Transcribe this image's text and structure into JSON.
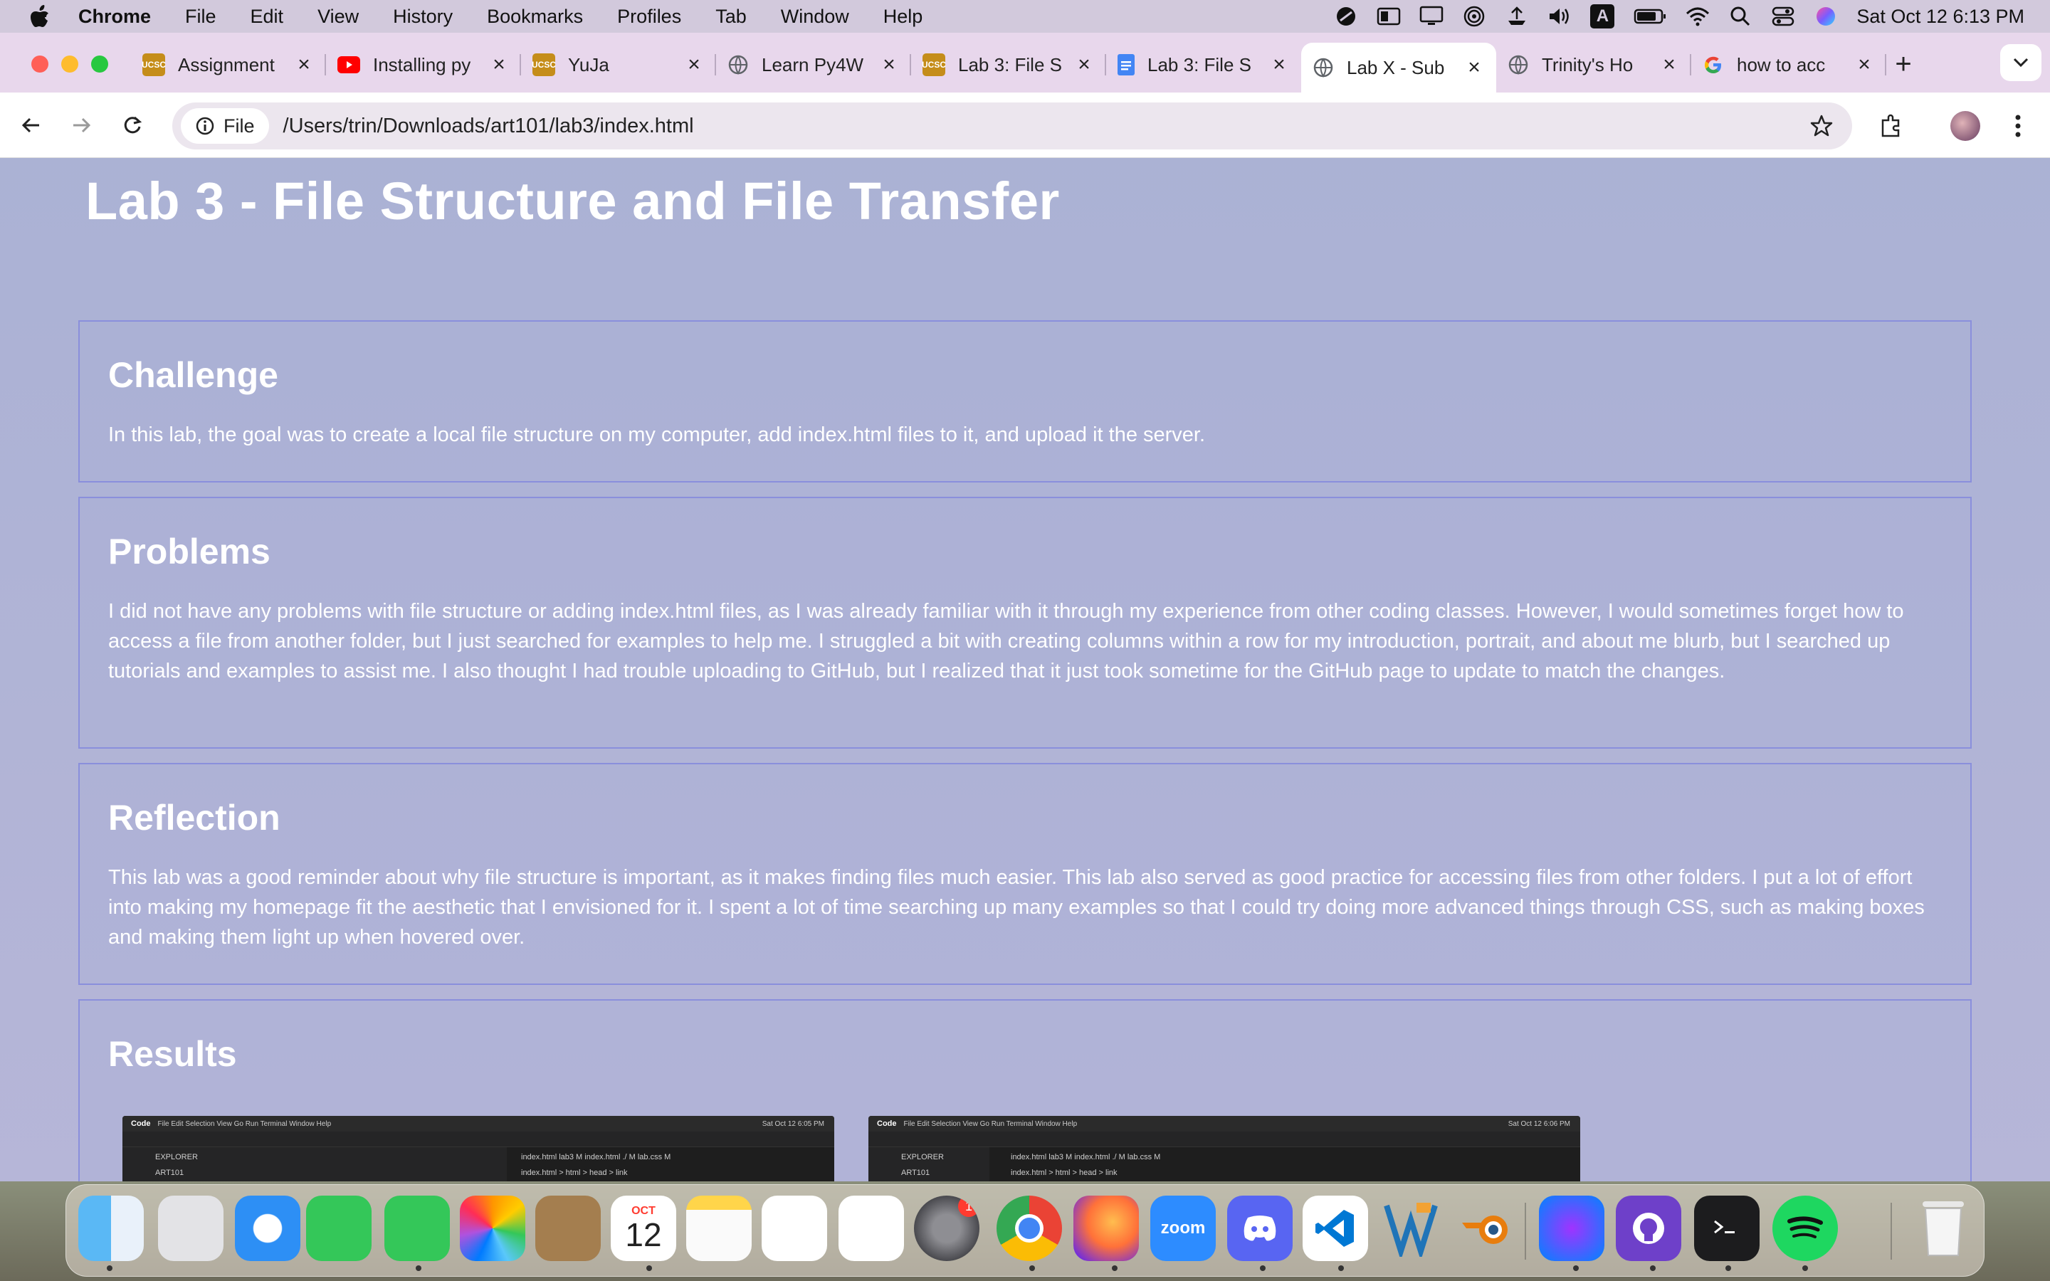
{
  "menubar": {
    "app_name": "Chrome",
    "items": [
      "File",
      "Edit",
      "View",
      "History",
      "Bookmarks",
      "Profiles",
      "Tab",
      "Window",
      "Help"
    ],
    "input_indicator": "A",
    "clock": "Sat Oct 12  6:13 PM"
  },
  "tabs": [
    {
      "title": "Assignment",
      "favicon": "ucsc-icon",
      "color": "#c58d1a"
    },
    {
      "title": "Installing py",
      "favicon": "youtube-icon",
      "color": "#ff0000"
    },
    {
      "title": "YuJa",
      "favicon": "ucsc-icon",
      "color": "#c58d1a"
    },
    {
      "title": "Learn Py4W",
      "favicon": "globe-icon",
      "color": "#5f6368"
    },
    {
      "title": "Lab 3: File S",
      "favicon": "ucsc-icon",
      "color": "#c58d1a"
    },
    {
      "title": "Lab 3: File S",
      "favicon": "docs-icon",
      "color": "#4285f4"
    },
    {
      "title": "Lab X - Sub",
      "favicon": "globe-icon",
      "color": "#5f6368",
      "active": true
    },
    {
      "title": "Trinity's Ho",
      "favicon": "globe-icon",
      "color": "#5f6368"
    },
    {
      "title": "how to acc",
      "favicon": "google-icon",
      "color": "#4285f4"
    }
  ],
  "toolbar": {
    "chip_label": "File",
    "url": "/Users/trin/Downloads/art101/lab3/index.html"
  },
  "page": {
    "title": "Lab 3 - File Structure and File Transfer",
    "sections": [
      {
        "heading": "Challenge",
        "body": "In this lab, the goal was to create a local file structure on my computer, add index.html files to it, and upload it the server."
      },
      {
        "heading": "Problems",
        "body": "I did not have any problems with file structure or adding index.html files, as I was already familiar with it through my experience from other coding classes. However, I would sometimes forget how to access a file from another folder, but I just searched for examples to help me. I struggled a bit with creating columns within a row for my introduction, portrait, and about me blurb, but I searched up tutorials and examples to assist me. I also thought I had trouble uploading to GitHub, but I realized that it just took sometime for the GitHub page to update to match the changes."
      },
      {
        "heading": "Reflection",
        "body": "This lab was a good reminder about why file structure is important, as it makes finding files much easier. This lab also served as good practice for accessing files from other folders. I put a lot of effort into making my homepage fit the aesthetic that I envisioned for it. I spent a lot of time searching up many examples so that I could try doing more advanced things through CSS, such as making boxes and making them light up when hovered over."
      },
      {
        "heading": "Results",
        "body": ""
      }
    ],
    "screenshots": [
      {
        "app": "Code",
        "menu": "File  Edit  Selection  View  Go  Run  Terminal  Window  Help",
        "clock": "Sat Oct 12  6:05 PM",
        "explorer": "EXPLORER",
        "folder": "ART101",
        "tabs": "index.html lab3 M    index.html ./ M    lab.css M",
        "path": "index.html > html > head > link"
      },
      {
        "app": "Code",
        "menu": "File  Edit  Selection  View  Go  Run  Terminal  Window  Help",
        "clock": "Sat Oct 12  6:06 PM",
        "explorer": "EXPLORER",
        "folder": "ART101",
        "tabs": "index.html lab3 M    index.html ./ M    lab.css M",
        "path": "index.html > html > head > link"
      }
    ]
  },
  "dock": {
    "apps": [
      "Finder",
      "Launchpad",
      "Safari",
      "FaceTime",
      "Messages",
      "Photos",
      "Contacts",
      "Calendar",
      "Notes",
      "Freeform",
      "Reminders",
      "System Settings",
      "Chrome",
      "Firefox",
      "Zoom",
      "Discord",
      "VS Code",
      "Vectorworks",
      "Blender",
      "Messenger",
      "GitHub Desktop",
      "Terminal",
      "Spotify",
      "Trash"
    ],
    "calendar_month": "OCT",
    "calendar_day": "12",
    "settings_badge": "1",
    "zoom_label": "zoom"
  }
}
